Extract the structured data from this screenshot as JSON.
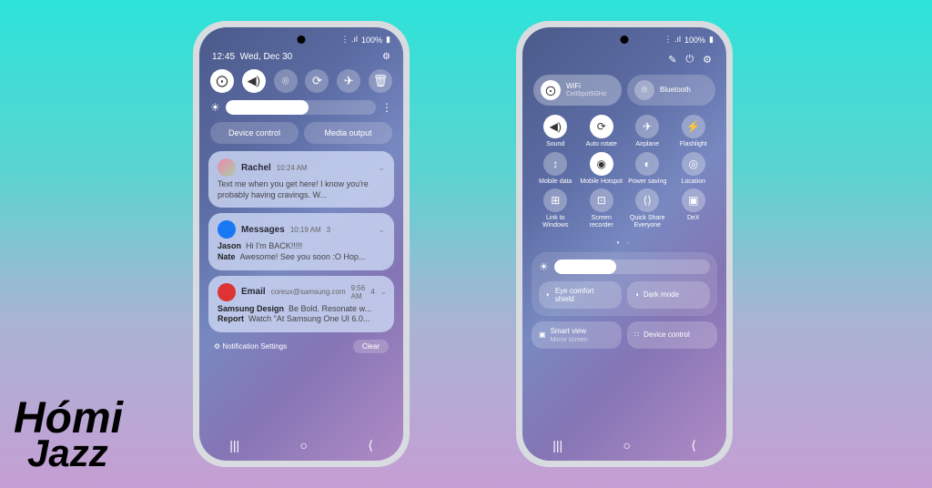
{
  "watermark": {
    "line1": "Hómi",
    "line2": "Jazz"
  },
  "status": {
    "signal": "⋮ .ıl",
    "battery": "100%"
  },
  "phone1": {
    "time": "12:45",
    "date": "Wed, Dec 30",
    "toggles": [
      {
        "icon": "wifi",
        "glyph": "⨀",
        "on": true
      },
      {
        "icon": "sound",
        "glyph": "◀)",
        "on": true
      },
      {
        "icon": "bluetooth",
        "glyph": "⌾",
        "on": false
      },
      {
        "icon": "rotate",
        "glyph": "⟳",
        "on": false
      },
      {
        "icon": "airplane",
        "glyph": "✈",
        "on": false
      },
      {
        "icon": "trash",
        "glyph": "🗑",
        "on": false
      }
    ],
    "device_control": "Device control",
    "media_output": "Media output",
    "notifs": [
      {
        "sender": "Rachel",
        "time": "10:24 AM",
        "body": "Text me when you get here! I know you're probably having cravings. W...",
        "avatar": "green"
      },
      {
        "sender": "Messages",
        "time": "10:19 AM",
        "count": "3",
        "lines": [
          {
            "n": "Jason",
            "t": "Hi I'm BACK!!!!!"
          },
          {
            "n": "Nate",
            "t": "Awesome! See you soon :O Hop..."
          }
        ],
        "avatar": "blue"
      },
      {
        "sender": "Email",
        "sub": "coreux@samsung.com",
        "time": "9:56 AM",
        "count": "4",
        "lines": [
          {
            "n": "Samsung Design",
            "t": "Be Bold. Resonate w..."
          },
          {
            "n": "Report",
            "t": "Watch \"At Samsung One UI 6.0..."
          }
        ],
        "avatar": "red"
      }
    ],
    "nsettings": "Notification Settings",
    "clear": "Clear"
  },
  "phone2": {
    "wifi": {
      "label": "WiFi",
      "sub": "CellSpot5GHz"
    },
    "bt": {
      "label": "Bluetooth"
    },
    "grid": [
      {
        "icon": "◀)",
        "label": "Sound",
        "on": true
      },
      {
        "icon": "⟳",
        "label": "Auto rotate",
        "on": true
      },
      {
        "icon": "✈",
        "label": "Airplane",
        "on": false
      },
      {
        "icon": "⚡",
        "label": "Flashlight",
        "on": false
      },
      {
        "icon": "↕",
        "label": "Mobile data",
        "on": false
      },
      {
        "icon": "◉",
        "label": "Mobile Hotspot",
        "on": true
      },
      {
        "icon": "◐",
        "label": "Power saving",
        "on": false
      },
      {
        "icon": "◎",
        "label": "Location",
        "on": false
      },
      {
        "icon": "⊞",
        "label": "Link to Windows",
        "on": false
      },
      {
        "icon": "⊡",
        "label": "Screen recorder",
        "on": false
      },
      {
        "icon": "⟨⟩",
        "label": "Quick Share Everyone",
        "on": false
      },
      {
        "icon": "▣",
        "label": "DeX",
        "on": false
      }
    ],
    "eye": "Eye comfort shield",
    "dark": "Dark mode",
    "smart": {
      "label": "Smart view",
      "sub": "Mirror screen"
    },
    "devctrl": "Device control"
  }
}
